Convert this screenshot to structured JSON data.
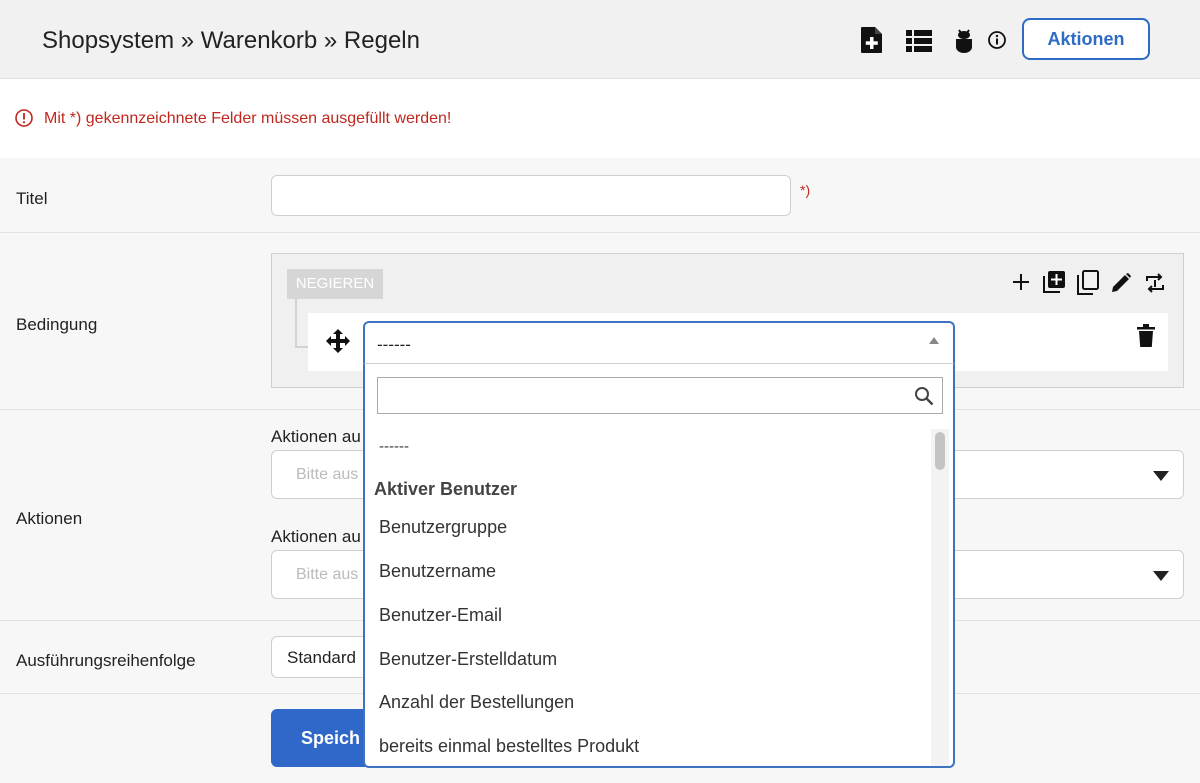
{
  "header": {
    "title": "Shopsystem » Warenkorb » Regeln",
    "icons": [
      "file-plus-icon",
      "list-icon",
      "bug-icon",
      "info-icon"
    ],
    "actions_label": "Aktionen"
  },
  "notice": {
    "text": "Mit *) gekennzeichnete Felder müssen ausgefüllt werden!"
  },
  "form": {
    "title_label": "Titel",
    "title_value": "",
    "required_marker": "*)",
    "condition_label": "Bedingung",
    "negate_label": "NEGIEREN",
    "condition_select_value": "------",
    "actions_label": "Aktionen",
    "actions_sub1_label": "Aktionen au",
    "actions_sub1_placeholder": "Bitte aus",
    "actions_sub2_label": "Aktionen au",
    "actions_sub2_placeholder": "Bitte aus",
    "order_label": "Ausführungsreihenfolge",
    "order_value": "Standard",
    "save_label": "Speich"
  },
  "dropdown": {
    "search_value": "",
    "items": [
      {
        "type": "option",
        "label": "------"
      },
      {
        "type": "group",
        "label": "Aktiver Benutzer"
      },
      {
        "type": "option",
        "label": "Benutzergruppe"
      },
      {
        "type": "option",
        "label": "Benutzername"
      },
      {
        "type": "option",
        "label": "Benutzer-Email"
      },
      {
        "type": "option",
        "label": "Benutzer-Erstelldatum"
      },
      {
        "type": "option",
        "label": "Anzahl der Bestellungen"
      },
      {
        "type": "option",
        "label": "bereits einmal bestelltes Produkt"
      }
    ]
  },
  "colors": {
    "accent": "#2e6bc4",
    "error": "#c0281f",
    "primary_button": "#3068c9"
  }
}
